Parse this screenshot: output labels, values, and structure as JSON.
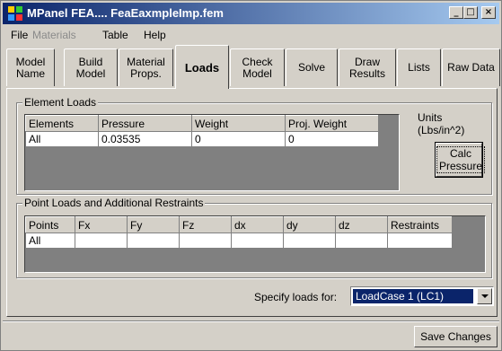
{
  "window": {
    "title": "MPanel FEA.... FeaEaxmpleImp.fem",
    "controls": {
      "minimize": "_",
      "maximize": "□",
      "close": "×"
    }
  },
  "menu": {
    "file": "File",
    "materials": "Materials",
    "table": "Table",
    "help": "Help"
  },
  "tabs": [
    {
      "label": "Model\nName"
    },
    {
      "label": "Build\nModel"
    },
    {
      "label": "Material\nProps."
    },
    {
      "label": "Loads"
    },
    {
      "label": "Check\nModel"
    },
    {
      "label": "Solve"
    },
    {
      "label": "Draw\nResults"
    },
    {
      "label": "Lists"
    },
    {
      "label": "Raw Data"
    }
  ],
  "element_loads": {
    "group_title": "Element Loads",
    "columns": [
      "Elements",
      "Pressure",
      "Weight",
      "Proj. Weight"
    ],
    "rows": [
      [
        "All",
        "0.03535",
        "0",
        "0"
      ]
    ],
    "units_line1": "Units",
    "units_line2": "(Lbs/in^2)",
    "calc_line1": "Calc",
    "calc_line2": "Pressure"
  },
  "point_loads": {
    "group_title": "Point Loads and Additional Restraints",
    "columns": [
      "Points",
      "Fx",
      "Fy",
      "Fz",
      "dx",
      "dy",
      "dz",
      "Restraints"
    ],
    "rows": [
      [
        "All",
        "",
        "",
        "",
        "",
        "",
        "",
        ""
      ]
    ]
  },
  "specify": {
    "label": "Specify loads for:",
    "selected": "LoadCase 1   (LC1)"
  },
  "save_button": "Save Changes",
  "colors": {
    "titlebar_start": "#0a246a",
    "titlebar_end": "#a6caf0",
    "face": "#d4d0c8",
    "selection": "#0a246a"
  }
}
